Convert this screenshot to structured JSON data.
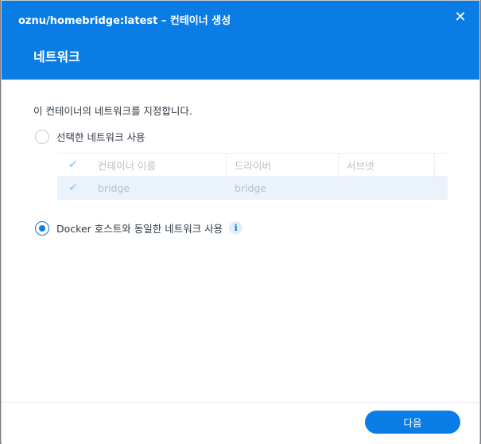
{
  "window": {
    "title": "oznu/homebridge:latest – 컨테이너 생성",
    "close_icon": "close-icon"
  },
  "header": {
    "step_title": "네트워크"
  },
  "content": {
    "description": "이 컨테이너의 네트워크를 지정합니다.",
    "option_selected_network": {
      "label": "선택한 네트워크 사용",
      "checked": false
    },
    "option_host_network": {
      "label": "Docker 호스트와 동일한 네트워크 사용",
      "checked": true,
      "info_icon": "info-icon",
      "info_glyph": "i"
    },
    "network_table": {
      "columns": [
        "컨테이너 이름",
        "드라이버",
        "서브넷"
      ],
      "rows": [
        {
          "name": "bridge",
          "driver": "bridge",
          "subnet": "",
          "checked": true
        }
      ]
    }
  },
  "footer": {
    "next_label": "다음"
  },
  "colors": {
    "accent": "#0a7ce6",
    "header_bg": "#0a7ce6"
  }
}
